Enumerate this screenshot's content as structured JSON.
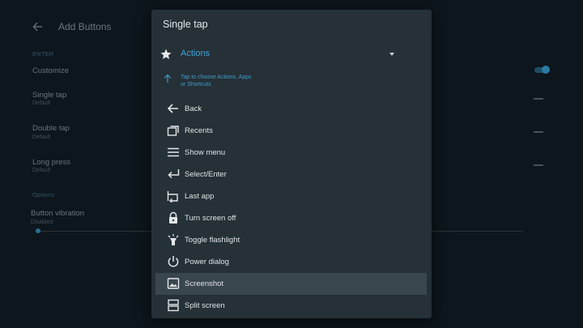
{
  "background": {
    "title": "Add Buttons",
    "section_enter": "ENTER",
    "customize_label": "Customize",
    "rows": [
      {
        "title": "Single tap",
        "subtitle": "Default"
      },
      {
        "title": "Double tap",
        "subtitle": "Default"
      },
      {
        "title": "Long press",
        "subtitle": "Default"
      }
    ],
    "section_options": "Options",
    "vibration": {
      "title": "Button vibration",
      "subtitle": "Disabled"
    }
  },
  "dialog": {
    "title": "Single tap",
    "selector_label": "Actions",
    "hint": "Tap to choose Actions, Apps or Shortcuts",
    "items": [
      {
        "label": "Back",
        "icon": "back-arrow-icon"
      },
      {
        "label": "Recents",
        "icon": "recents-icon"
      },
      {
        "label": "Show menu",
        "icon": "menu-icon"
      },
      {
        "label": "Select/Enter",
        "icon": "enter-icon"
      },
      {
        "label": "Last app",
        "icon": "last-app-icon"
      },
      {
        "label": "Turn screen off",
        "icon": "lock-icon"
      },
      {
        "label": "Toggle flashlight",
        "icon": "flashlight-icon"
      },
      {
        "label": "Power dialog",
        "icon": "power-icon"
      },
      {
        "label": "Screenshot",
        "icon": "screenshot-icon"
      },
      {
        "label": "Split screen",
        "icon": "split-screen-icon"
      }
    ],
    "highlighted_item": "Screenshot"
  },
  "colors": {
    "accent": "#40a6d8",
    "dialog_bg": "#253037",
    "highlight_bg": "#3a464d"
  }
}
